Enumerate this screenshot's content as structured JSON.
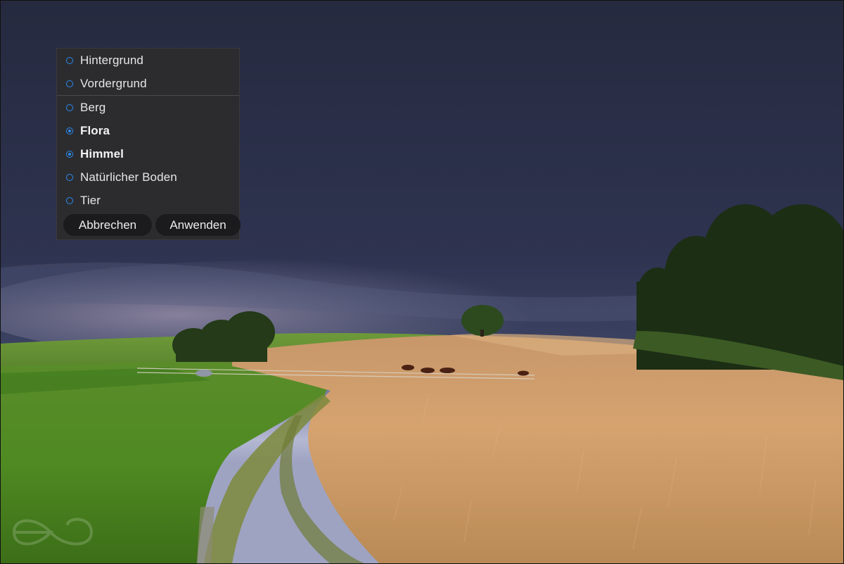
{
  "scene": {
    "description_icon": "landscape-photo"
  },
  "mask_panel": {
    "groups": [
      {
        "options": [
          {
            "label": "Hintergrund",
            "checked": false
          },
          {
            "label": "Vordergrund",
            "checked": false
          }
        ]
      },
      {
        "options": [
          {
            "label": "Berg",
            "checked": false
          },
          {
            "label": "Flora",
            "checked": true
          },
          {
            "label": "Himmel",
            "checked": true
          },
          {
            "label": "Natürlicher Boden",
            "checked": false
          },
          {
            "label": "Tier",
            "checked": false
          }
        ]
      }
    ],
    "cancel_label": "Abbrechen",
    "apply_label": "Anwenden",
    "accent_color": "#2a8cf0"
  },
  "watermark": {
    "icon": "infinity-logo-icon"
  }
}
